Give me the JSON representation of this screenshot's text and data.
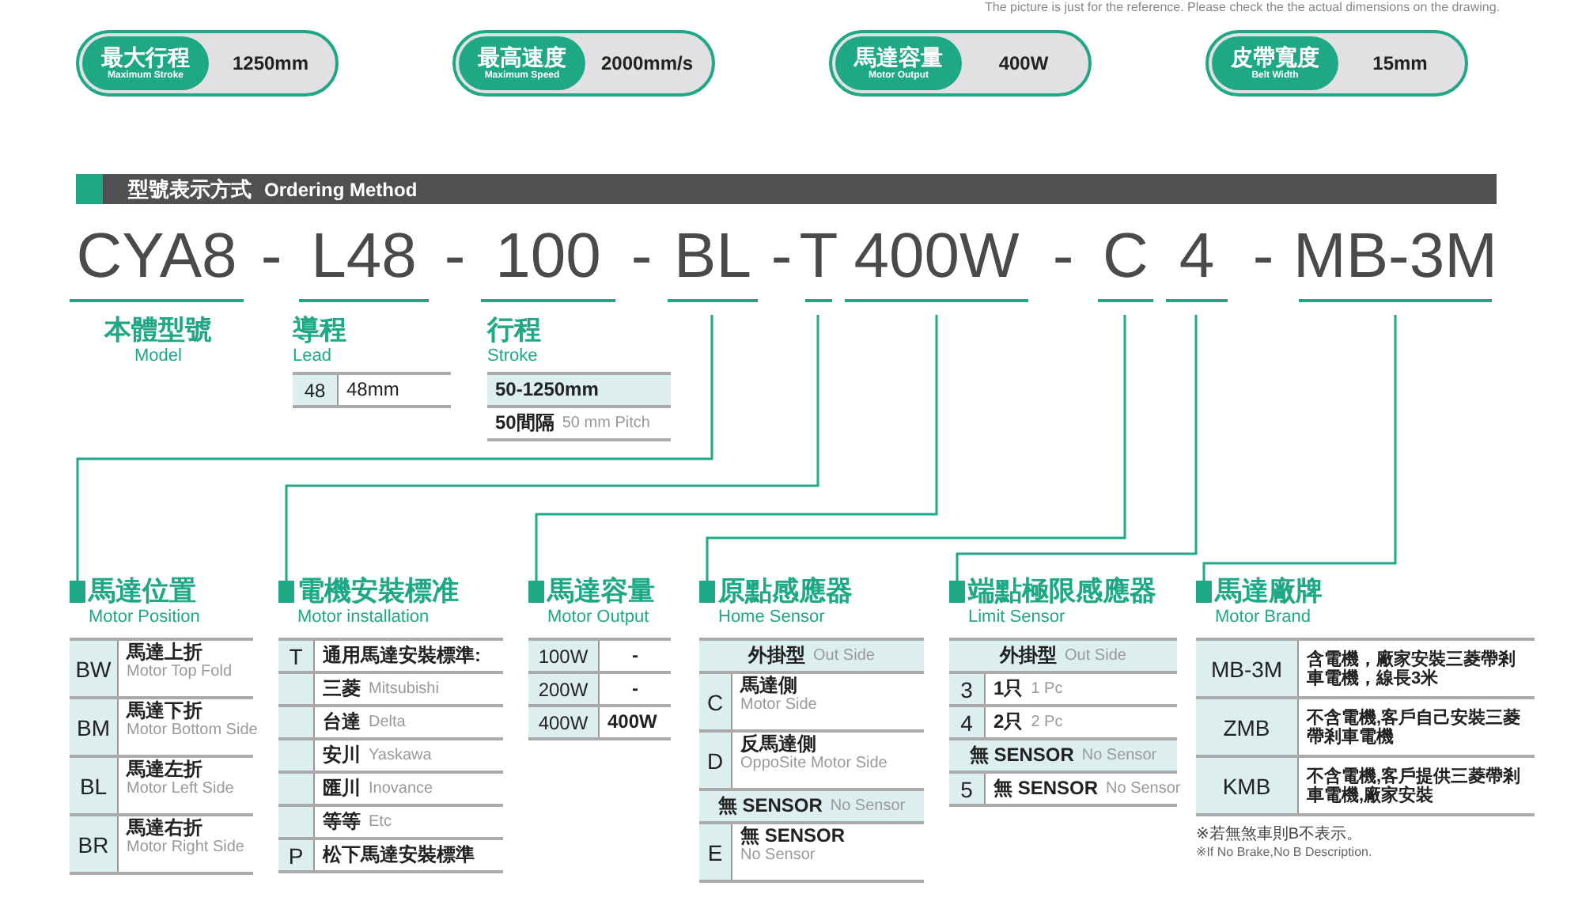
{
  "note": "The picture is just for the reference. Please check the the actual dimensions on the drawing.",
  "specs": [
    {
      "label": "最大行程",
      "sublabel": "Maximum Stroke",
      "value": "1250mm"
    },
    {
      "label": "最高速度",
      "sublabel": "Maximum Speed",
      "value": "2000mm/s"
    },
    {
      "label": "馬達容量",
      "sublabel": "Motor Output",
      "value": "400W"
    },
    {
      "label": "皮帶寬度",
      "sublabel": "Belt Width",
      "value": "15mm"
    }
  ],
  "header": {
    "title": "型號表示方式",
    "subtitle": "Ordering Method"
  },
  "code": [
    {
      "text": "CYA8",
      "kind": "part"
    },
    {
      "text": "-",
      "kind": "separator"
    },
    {
      "text": "L48",
      "kind": "part"
    },
    {
      "text": "-",
      "kind": "separator"
    },
    {
      "text": "100",
      "kind": "part"
    },
    {
      "text": "-",
      "kind": "separator"
    },
    {
      "text": "BL",
      "kind": "part"
    },
    {
      "text": "-",
      "kind": "separator"
    },
    {
      "text": "T",
      "kind": "part"
    },
    {
      "text": "400W",
      "kind": "part"
    },
    {
      "text": "-",
      "kind": "separator"
    },
    {
      "text": "C",
      "kind": "part"
    },
    {
      "text": "4",
      "kind": "part"
    },
    {
      "text": "-",
      "kind": "separator"
    },
    {
      "text": "MB-3M",
      "kind": "part"
    }
  ],
  "fields": [
    {
      "title": "本體型號",
      "subtitle": "Model"
    },
    {
      "title": "導程",
      "subtitle": "Lead",
      "rows": [
        {
          "kind": "pair",
          "code": "48",
          "text": "48mm"
        }
      ]
    },
    {
      "title": "行程",
      "subtitle": "Stroke",
      "rows": [
        {
          "kind": "highlight",
          "text": "50-1250mm"
        },
        {
          "kind": "plain",
          "text": "50間隔",
          "subtext": "50 mm Pitch"
        }
      ]
    }
  ],
  "sections": [
    {
      "title": "馬達位置",
      "subtitle": "Motor Position",
      "rows": [
        {
          "kind": "stacked",
          "code": "BW",
          "text": "馬達上折",
          "subtext": "Motor Top Fold"
        },
        {
          "kind": "stacked",
          "code": "BM",
          "text": "馬達下折",
          "subtext": "Motor Bottom Side"
        },
        {
          "kind": "stacked",
          "code": "BL",
          "text": "馬達左折",
          "subtext": "Motor Left Side"
        },
        {
          "kind": "stacked",
          "code": "BR",
          "text": "馬達右折",
          "subtext": "Motor Right Side"
        }
      ]
    },
    {
      "title": "電機安裝標准",
      "subtitle": "Motor installation",
      "rows": [
        {
          "kind": "inline",
          "code": "T",
          "text": "通用馬達安裝標準:"
        },
        {
          "kind": "inline",
          "text": "三菱",
          "subtext": "Mitsubishi"
        },
        {
          "kind": "inline",
          "text": "台達",
          "subtext": "Delta"
        },
        {
          "kind": "inline",
          "text": "安川",
          "subtext": "Yaskawa"
        },
        {
          "kind": "inline",
          "text": "匯川",
          "subtext": "Inovance"
        },
        {
          "kind": "inline",
          "text": "等等",
          "subtext": "Etc"
        },
        {
          "kind": "inline",
          "code": "P",
          "text": "松下馬達安裝標準"
        }
      ]
    },
    {
      "title": "馬達容量",
      "subtitle": "Motor Output",
      "rows": [
        {
          "kind": "inline",
          "code": "100W",
          "text": "-"
        },
        {
          "kind": "inline",
          "code": "200W",
          "text": "-"
        },
        {
          "kind": "inline",
          "code": "400W",
          "text": "400W"
        }
      ]
    },
    {
      "title": "原點感應器",
      "subtitle": "Home Sensor",
      "rows": [
        {
          "kind": "heading",
          "text": "外掛型",
          "subtext": "Out Side"
        },
        {
          "kind": "stacked",
          "code": "C",
          "text": "馬達側",
          "subtext": "Motor Side"
        },
        {
          "kind": "stacked",
          "code": "D",
          "text": "反馬達側",
          "subtext": "OppoSite Motor Side"
        },
        {
          "kind": "heading",
          "text": "無 SENSOR",
          "subtext": "No Sensor"
        },
        {
          "kind": "stacked",
          "code": "E",
          "text": "無  SENSOR",
          "subtext": "No Sensor"
        }
      ]
    },
    {
      "title": "端點極限感應器",
      "subtitle": "Limit Sensor",
      "rows": [
        {
          "kind": "heading",
          "text": "外掛型",
          "subtext": "Out Side"
        },
        {
          "kind": "inline",
          "code": "3",
          "text": "1只",
          "subtext": "1 Pc"
        },
        {
          "kind": "inline",
          "code": "4",
          "text": "2只",
          "subtext": "2 Pc"
        },
        {
          "kind": "heading",
          "text": "無 SENSOR",
          "subtext": "No Sensor"
        },
        {
          "kind": "inline",
          "code": "5",
          "text": "無 SENSOR",
          "subtext": "No Sensor"
        }
      ]
    },
    {
      "title": "馬達廠牌",
      "subtitle": "Motor Brand",
      "rows": [
        {
          "kind": "wrap",
          "code": "MB-3M",
          "text": "含電機，廠家安裝三菱帶剎車電機，線長3米"
        },
        {
          "kind": "wrap",
          "code": "ZMB",
          "text": "不含電機,客戶自己安裝三菱帶剎車電機"
        },
        {
          "kind": "wrap",
          "code": "KMB",
          "text": "不含電機,客戶提供三菱帶剎車電機,廠家安裝"
        }
      ],
      "notes": [
        "※若無煞車則B不表示。",
        "※If No Brake,No B Description."
      ]
    }
  ]
}
